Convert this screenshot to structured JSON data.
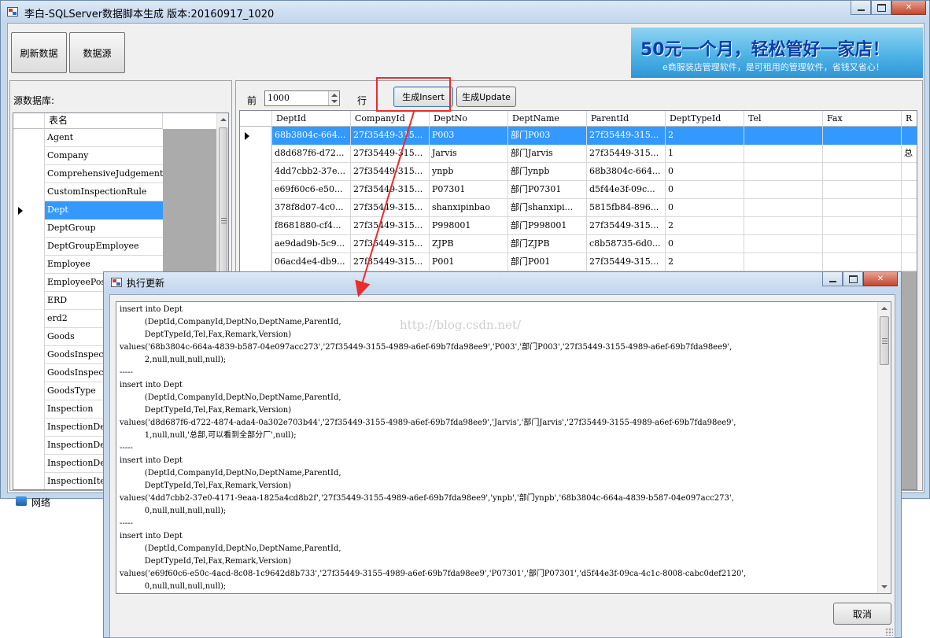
{
  "main_window": {
    "title": "李白-SQLServer数据脚本生成 版本:20160917_1020",
    "refresh_label": "刷新数据",
    "datasource_label": "数据源",
    "banner": {
      "main_text": "50元一个月，轻松管好一家店！",
      "sub_text": "e商服装店管理软件，是可租用的管理软件，省钱又省心！",
      "colors": {
        "background": "#4fb3e6",
        "text": "#0b3ea8"
      }
    },
    "left_panel": {
      "label": "源数据库:",
      "column_header": "表名",
      "selected_index": 4,
      "tables": [
        "Agent",
        "Company",
        "ComprehensiveJudgement",
        "CustomInspectionRule",
        "Dept",
        "DeptGroup",
        "DeptGroupEmployee",
        "Employee",
        "EmployeePosit",
        "ERD",
        "erd2",
        "Goods",
        "GoodsInspecti",
        "GoodsInspecti",
        "GoodsType",
        "Inspection",
        "InspectionDet",
        "InspectionDet",
        "InspectionDet",
        "InspectionIte"
      ]
    },
    "toolbar": {
      "front_label": "前",
      "rows_value": "1000",
      "rows_label": "行",
      "insert_label": "生成Insert",
      "update_label": "生成Update"
    },
    "data_grid": {
      "columns": [
        "DeptId",
        "CompanyId",
        "DeptNo",
        "DeptName",
        "ParentId",
        "DeptTypeId",
        "Tel",
        "Fax",
        "R"
      ],
      "selected_index": 0,
      "rows": [
        [
          "68b3804c-664...",
          "27f35449-315...",
          "P003",
          "部门P003",
          "27f35449-315...",
          "2",
          "",
          "",
          ""
        ],
        [
          "d8d687f6-d72...",
          "27f35449-315...",
          "Jarvis",
          "部门Jarvis",
          "27f35449-315...",
          "1",
          "",
          "",
          "总"
        ],
        [
          "4dd7cbb2-37e...",
          "27f35449-315...",
          "ynpb",
          "部门ynpb",
          "68b3804c-664...",
          "0",
          "",
          "",
          ""
        ],
        [
          "e69f60c6-e50...",
          "27f35449-315...",
          "P07301",
          "部门P07301",
          "d5f44e3f-09c...",
          "0",
          "",
          "",
          ""
        ],
        [
          "378f8d07-4c0...",
          "27f35449-315...",
          "shanxipinbao",
          "部门shanxipi...",
          "5815fb84-896...",
          "0",
          "",
          "",
          ""
        ],
        [
          "f8681880-cf4...",
          "27f35449-315...",
          "P998001",
          "部门P998001",
          "27f35449-315...",
          "2",
          "",
          "",
          ""
        ],
        [
          "ae9dad9b-5c9...",
          "27f35449-315...",
          "ZJPB",
          "部门ZJPB",
          "c8b58735-6d0...",
          "0",
          "",
          "",
          ""
        ],
        [
          "06acd4e4-db9...",
          "27f35449-315...",
          "P001",
          "部门P001",
          "27f35449-315...",
          "2",
          "",
          "",
          ""
        ]
      ]
    },
    "desktop_label": "网络"
  },
  "dialog": {
    "title": "执行更新",
    "watermark": "http://blog.csdn.net/",
    "cancel_label": "取消",
    "sql_text": "insert into Dept\n          (DeptId,CompanyId,DeptNo,DeptName,ParentId,\n          DeptTypeId,Tel,Fax,Remark,Version)\nvalues('68b3804c-664a-4839-b587-04e097acc273','27f35449-3155-4989-a6ef-69b7fda98ee9','P003','部门P003','27f35449-3155-4989-a6ef-69b7fda98ee9',\n          2,null,null,null,null);\n-----\ninsert into Dept\n          (DeptId,CompanyId,DeptNo,DeptName,ParentId,\n          DeptTypeId,Tel,Fax,Remark,Version)\nvalues('d8d687f6-d722-4874-ada4-0a302e703b44','27f35449-3155-4989-a6ef-69b7fda98ee9','Jarvis','部门Jarvis','27f35449-3155-4989-a6ef-69b7fda98ee9',\n          1,null,null,'总部,可以看到全部分厂',null);\n-----\ninsert into Dept\n          (DeptId,CompanyId,DeptNo,DeptName,ParentId,\n          DeptTypeId,Tel,Fax,Remark,Version)\nvalues('4dd7cbb2-37e0-4171-9eaa-1825a4cd8b2f','27f35449-3155-4989-a6ef-69b7fda98ee9','ynpb','部门ynpb','68b3804c-664a-4839-b587-04e097acc273',\n          0,null,null,null,null);\n-----\ninsert into Dept\n          (DeptId,CompanyId,DeptNo,DeptName,ParentId,\n          DeptTypeId,Tel,Fax,Remark,Version)\nvalues('e69f60c6-e50c-4acd-8c08-1c9642d8b733','27f35449-3155-4989-a6ef-69b7fda98ee9','P07301','部门P07301','d5f44e3f-09ca-4c1c-8008-cabc0def2120',\n          0,null,null,null,null);"
  },
  "annotation_colors": {
    "highlight_box": "#ec2b2b",
    "arrow": "#ec2b2b"
  }
}
